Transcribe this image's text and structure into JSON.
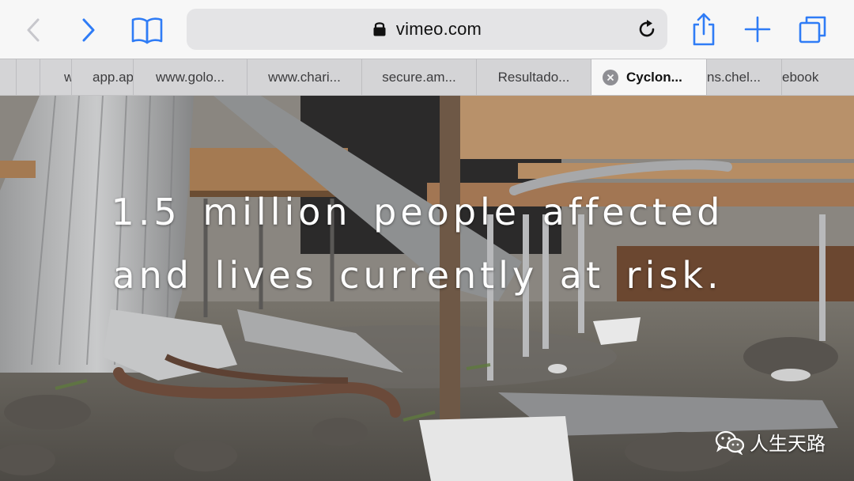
{
  "browser": {
    "url": "vimeo.com",
    "accent_color": "#2f7cf6",
    "icons": {
      "back": "chevron-left-icon",
      "forward": "chevron-right-icon",
      "bookmarks": "book-icon",
      "lock": "lock-icon",
      "reload": "reload-icon",
      "share": "share-icon",
      "new_tab": "plus-icon",
      "tabs": "tabs-icon"
    }
  },
  "tabs": [
    {
      "label": "w"
    },
    {
      "label": "app.ap"
    },
    {
      "label": "www.golo..."
    },
    {
      "label": "www.chari..."
    },
    {
      "label": "secure.am..."
    },
    {
      "label": "Resultado..."
    },
    {
      "label": "Cyclon...",
      "active": true
    },
    {
      "label": "ns.chel..."
    },
    {
      "label": "ebook"
    }
  ],
  "video": {
    "caption_line1": "1.5 million people affected",
    "caption_line2": "and lives currently at risk."
  },
  "watermark": {
    "text": "人生天路",
    "icon": "wechat-icon"
  }
}
